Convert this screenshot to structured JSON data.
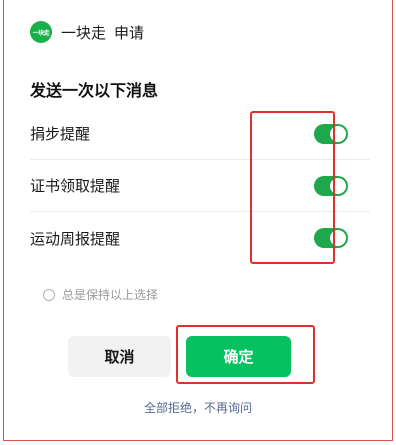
{
  "header": {
    "logo_text": "一块走",
    "app_name": "一块走",
    "action": "申请"
  },
  "section_title": "发送一次以下消息",
  "rows": [
    {
      "label": "捐步提醒",
      "enabled": true
    },
    {
      "label": "证书领取提醒",
      "enabled": true
    },
    {
      "label": "运动周报提醒",
      "enabled": true
    }
  ],
  "remember": {
    "label": "总是保持以上选择",
    "checked": false
  },
  "buttons": {
    "cancel": "取消",
    "confirm": "确定"
  },
  "reject_link": "全部拒绝，不再询问",
  "colors": {
    "accent_green": "#07c160",
    "toggle_green": "#1fa84b",
    "highlight_red": "#e0312b",
    "link_blue": "#576b95"
  }
}
